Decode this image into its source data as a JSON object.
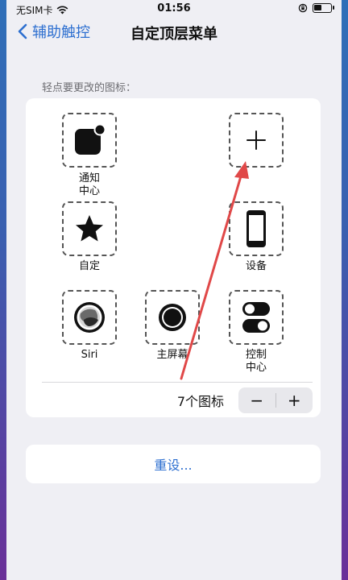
{
  "status_bar": {
    "carrier": "无SIM卡",
    "time": "01:56"
  },
  "nav": {
    "back_label": "辅助触控",
    "title": "自定顶层菜单"
  },
  "section_label": "轻点要更改的图标：",
  "icons": [
    {
      "label_line1": "通知",
      "label_line2": "中心",
      "icon": "notification-center-icon"
    },
    {
      "label_line1": "",
      "label_line2": "",
      "icon": "plus-icon"
    },
    {
      "label_line1": "自定",
      "label_line2": "",
      "icon": "star-icon"
    },
    {
      "label_line1": "设备",
      "label_line2": "",
      "icon": "device-icon"
    },
    {
      "label_line1": "Siri",
      "label_line2": "",
      "icon": "siri-icon"
    },
    {
      "label_line1": "主屏幕",
      "label_line2": "",
      "icon": "home-icon"
    },
    {
      "label_line1": "控制",
      "label_line2": "中心",
      "icon": "control-center-icon"
    }
  ],
  "footer": {
    "count_label": "7个图标",
    "minus_label": "−",
    "plus_label": "+"
  },
  "reset_label": "重设...",
  "colors": {
    "accent": "#2d6fd0",
    "annotation_arrow": "#e04848"
  }
}
